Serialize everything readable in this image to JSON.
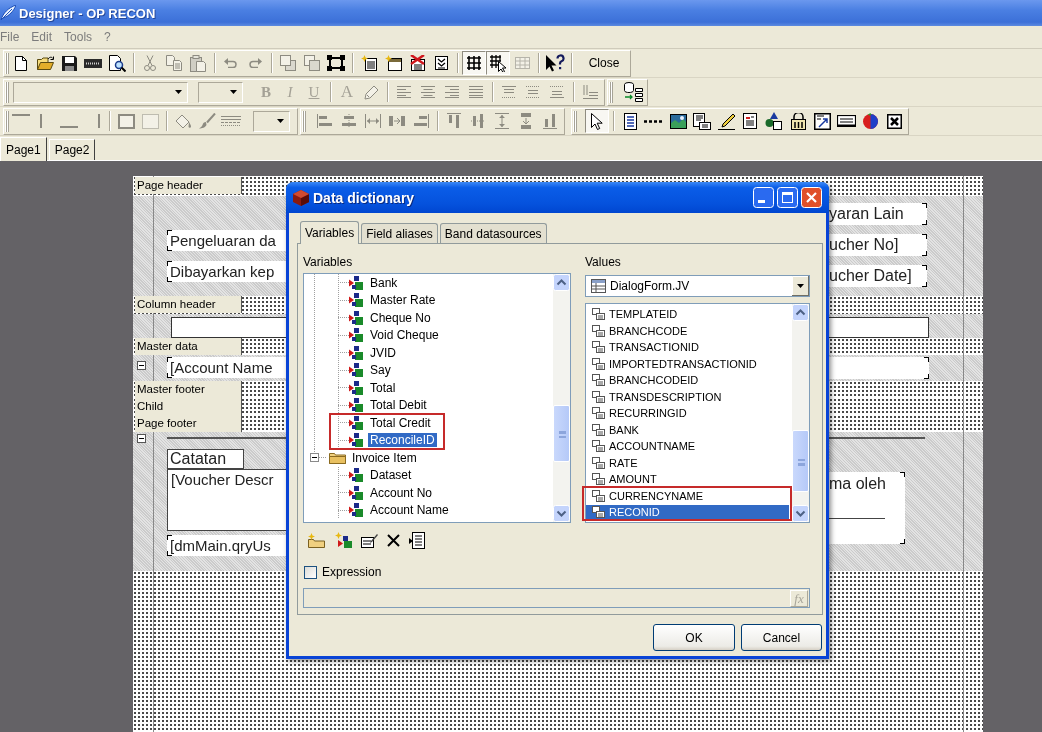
{
  "window": {
    "title": "Designer - OP RECON"
  },
  "menu": [
    {
      "label": "File"
    },
    {
      "label": "Edit"
    },
    {
      "label": "Tools"
    },
    {
      "label": "?"
    }
  ],
  "toolbar_rows": [
    {
      "toolbars": [
        {
          "items": [
            {
              "kind": "tool",
              "pressed": false,
              "disabled": false
            },
            {
              "kind": "tool",
              "pressed": false,
              "disabled": false
            },
            {
              "kind": "tool",
              "pressed": false,
              "disabled": false
            },
            {
              "kind": "tool",
              "pressed": false,
              "disabled": false
            },
            {
              "kind": "tool",
              "pressed": false,
              "disabled": false
            },
            {
              "kind": "separator"
            },
            {
              "kind": "tool",
              "pressed": false,
              "disabled": true
            },
            {
              "kind": "tool",
              "pressed": false,
              "disabled": true
            },
            {
              "kind": "tool",
              "pressed": false,
              "disabled": true
            },
            {
              "kind": "separator"
            },
            {
              "kind": "tool",
              "pressed": false,
              "disabled": true
            },
            {
              "kind": "tool",
              "pressed": false,
              "disabled": true
            },
            {
              "kind": "separator"
            },
            {
              "kind": "tool",
              "pressed": false,
              "disabled": true
            },
            {
              "kind": "tool",
              "pressed": false,
              "disabled": true
            },
            {
              "kind": "tool",
              "pressed": false,
              "disabled": false
            },
            {
              "kind": "separator"
            },
            {
              "kind": "tool",
              "pressed": false,
              "disabled": false
            },
            {
              "kind": "tool",
              "pressed": false,
              "disabled": false
            },
            {
              "kind": "tool",
              "pressed": false,
              "disabled": false
            },
            {
              "kind": "tool",
              "pressed": false,
              "disabled": false
            },
            {
              "kind": "separator"
            },
            {
              "kind": "tool",
              "pressed": true,
              "disabled": false
            },
            {
              "kind": "tool",
              "pressed": true,
              "disabled": false
            },
            {
              "kind": "tool",
              "pressed": false,
              "disabled": true
            },
            {
              "kind": "separator"
            },
            {
              "kind": "tool",
              "pressed": false,
              "disabled": false
            },
            {
              "kind": "separator"
            },
            {
              "kind": "command",
              "label": "Close"
            }
          ]
        }
      ]
    },
    {
      "toolbars": [
        {
          "items": [
            {
              "kind": "combo",
              "disabled": true
            },
            {
              "kind": "combo",
              "disabled": true
            },
            {
              "kind": "bold",
              "label": "B",
              "disabled": true
            },
            {
              "kind": "italic",
              "label": "I",
              "disabled": true
            },
            {
              "kind": "underline",
              "label": "U",
              "disabled": true
            },
            {
              "kind": "separator"
            },
            {
              "kind": "glyph",
              "label": "A",
              "disabled": true
            },
            {
              "kind": "tool",
              "pressed": false,
              "disabled": true
            },
            {
              "kind": "separator"
            },
            {
              "kind": "tool",
              "pressed": false,
              "disabled": true
            },
            {
              "kind": "tool",
              "pressed": false,
              "disabled": true
            },
            {
              "kind": "tool",
              "pressed": false,
              "disabled": true
            },
            {
              "kind": "tool",
              "pressed": false,
              "disabled": true
            },
            {
              "kind": "separator"
            },
            {
              "kind": "tool",
              "pressed": false,
              "disabled": true
            },
            {
              "kind": "tool",
              "pressed": false,
              "disabled": true
            },
            {
              "kind": "tool",
              "pressed": false,
              "disabled": true
            },
            {
              "kind": "separator"
            },
            {
              "kind": "tool",
              "pressed": false,
              "disabled": true
            }
          ]
        },
        {
          "items": [
            {
              "kind": "tool",
              "pressed": false,
              "disabled": false
            }
          ]
        }
      ]
    },
    {
      "toolbars": [
        {
          "items": [
            {
              "kind": "tool",
              "pressed": false,
              "disabled": true
            },
            {
              "kind": "tool",
              "pressed": false,
              "disabled": true
            },
            {
              "kind": "tool",
              "pressed": false,
              "disabled": true
            },
            {
              "kind": "tool",
              "pressed": false,
              "disabled": true
            },
            {
              "kind": "separator"
            },
            {
              "kind": "tool",
              "pressed": false,
              "disabled": true
            },
            {
              "kind": "tool",
              "pressed": false,
              "disabled": true
            },
            {
              "kind": "separator"
            },
            {
              "kind": "tool",
              "pressed": false,
              "disabled": true
            },
            {
              "kind": "tool",
              "pressed": false,
              "disabled": true
            },
            {
              "kind": "tool",
              "pressed": false,
              "disabled": true
            },
            {
              "kind": "combo",
              "disabled": true
            }
          ]
        },
        {
          "items": [
            {
              "kind": "tool",
              "pressed": false,
              "disabled": true
            },
            {
              "kind": "tool",
              "pressed": false,
              "disabled": true
            },
            {
              "kind": "tool",
              "pressed": false,
              "disabled": true
            },
            {
              "kind": "tool",
              "pressed": false,
              "disabled": true
            },
            {
              "kind": "tool",
              "pressed": false,
              "disabled": true
            },
            {
              "kind": "separator"
            },
            {
              "kind": "tool",
              "pressed": false,
              "disabled": true
            },
            {
              "kind": "tool",
              "pressed": false,
              "disabled": true
            },
            {
              "kind": "tool",
              "pressed": false,
              "disabled": true
            },
            {
              "kind": "tool",
              "pressed": false,
              "disabled": true
            },
            {
              "kind": "tool",
              "pressed": false,
              "disabled": true
            }
          ]
        },
        {
          "items": [
            {
              "kind": "tool",
              "pressed": true,
              "disabled": false
            },
            {
              "kind": "separator"
            },
            {
              "kind": "tool",
              "pressed": false,
              "disabled": false
            },
            {
              "kind": "tool",
              "pressed": false,
              "disabled": false
            },
            {
              "kind": "tool",
              "pressed": false,
              "disabled": false
            },
            {
              "kind": "tool",
              "pressed": false,
              "disabled": false
            },
            {
              "kind": "tool",
              "pressed": false,
              "disabled": false
            },
            {
              "kind": "tool",
              "pressed": false,
              "disabled": false
            },
            {
              "kind": "tool",
              "pressed": false,
              "disabled": false
            },
            {
              "kind": "tool",
              "pressed": false,
              "disabled": false
            },
            {
              "kind": "tool",
              "pressed": false,
              "disabled": false
            },
            {
              "kind": "tool",
              "pressed": false,
              "disabled": false
            },
            {
              "kind": "tool",
              "pressed": false,
              "disabled": false
            },
            {
              "kind": "tool",
              "pressed": false,
              "disabled": false
            }
          ]
        }
      ]
    }
  ],
  "page_tabs": [
    {
      "label": "Page1",
      "selected": true
    },
    {
      "label": "Page2",
      "selected": false
    }
  ],
  "report": {
    "bands": [
      {
        "label": "Page header",
        "collapse_box": false,
        "left": [
          {
            "kind": "field",
            "text": "Pengeluaran da"
          },
          {
            "kind": "field",
            "text": "Dibayarkan kep"
          }
        ],
        "right": [
          {
            "kind": "field",
            "text": "yaran Lain"
          },
          {
            "kind": "field",
            "text": "ucher No]"
          },
          {
            "kind": "field",
            "text": "ucher Date]"
          }
        ]
      },
      {
        "label": "Column header",
        "collapse_box": false,
        "left": [
          {
            "kind": "frame"
          }
        ],
        "right": [
          {
            "kind": "frame"
          }
        ]
      },
      {
        "label": "Master data",
        "collapse_box": true,
        "left": [
          {
            "kind": "field",
            "text": "[Account Name"
          }
        ],
        "right": [
          {
            "kind": "field"
          }
        ]
      },
      {
        "label": "Master footer",
        "collapse_box": false
      },
      {
        "label": "Child",
        "collapse_box": false
      },
      {
        "label": "Page footer",
        "collapse_box": true,
        "left": [
          {
            "kind": "caption",
            "text": "Catatan"
          },
          {
            "kind": "memo",
            "text": "[Voucher Descr"
          },
          {
            "kind": "field",
            "text": "[dmMain.qryUs"
          }
        ],
        "right": [
          {
            "kind": "signature",
            "text": "ma oleh"
          }
        ]
      }
    ]
  },
  "dialog": {
    "title": "Data dictionary",
    "tabs": [
      {
        "label": "Variables",
        "selected": true
      },
      {
        "label": "Field aliases",
        "selected": false
      },
      {
        "label": "Band datasources",
        "selected": false
      }
    ],
    "variables": {
      "label": "Variables",
      "tree": [
        {
          "children": [
            {
              "label": "Bank",
              "selected": false,
              "framed": false
            },
            {
              "label": "Master Rate",
              "selected": false,
              "framed": false
            },
            {
              "label": "Cheque No",
              "selected": false,
              "framed": false
            },
            {
              "label": "Void Cheque",
              "selected": false,
              "framed": false
            },
            {
              "label": "JVID",
              "selected": false,
              "framed": false
            },
            {
              "label": "Say",
              "selected": false,
              "framed": false
            },
            {
              "label": "Total",
              "selected": false,
              "framed": false
            },
            {
              "label": "Total Debit",
              "selected": false,
              "framed": false
            },
            {
              "label": "Total Credit",
              "selected": false,
              "framed": true
            },
            {
              "label": "ReconcileID",
              "selected": true,
              "framed": true
            }
          ]
        },
        {
          "label": "Invoice Item",
          "expanded": true,
          "selected": false,
          "framed": false,
          "children": [
            {
              "label": "Dataset",
              "selected": false,
              "framed": false
            },
            {
              "label": "Account No",
              "selected": false,
              "framed": false
            },
            {
              "label": "Account Name",
              "selected": false,
              "framed": false
            }
          ]
        }
      ]
    },
    "values": {
      "label": "Values",
      "source": "DialogForm.JV",
      "items": [
        {
          "label": "TEMPLATEID",
          "selected": false,
          "framed": false
        },
        {
          "label": "BRANCHCODE",
          "selected": false,
          "framed": false
        },
        {
          "label": "TRANSACTIONID",
          "selected": false,
          "framed": false
        },
        {
          "label": "IMPORTEDTRANSACTIONID",
          "selected": false,
          "framed": false
        },
        {
          "label": "BRANCHCODEID",
          "selected": false,
          "framed": false
        },
        {
          "label": "TRANSDESCRIPTION",
          "selected": false,
          "framed": false
        },
        {
          "label": "RECURRINGID",
          "selected": false,
          "framed": false
        },
        {
          "label": "BANK",
          "selected": false,
          "framed": false
        },
        {
          "label": "ACCOUNTNAME",
          "selected": false,
          "framed": false
        },
        {
          "label": "RATE",
          "selected": false,
          "framed": false
        },
        {
          "label": "AMOUNT",
          "selected": false,
          "framed": false
        },
        {
          "label": "CURRENCYNAME",
          "selected": false,
          "framed": true
        },
        {
          "label": "RECONID",
          "selected": true,
          "framed": true
        }
      ]
    },
    "expression": {
      "label": "Expression",
      "checked": false,
      "function_button": {
        "label": "fx",
        "disabled": true
      }
    },
    "buttons": [
      {
        "label": "OK"
      },
      {
        "label": "Cancel"
      }
    ]
  }
}
